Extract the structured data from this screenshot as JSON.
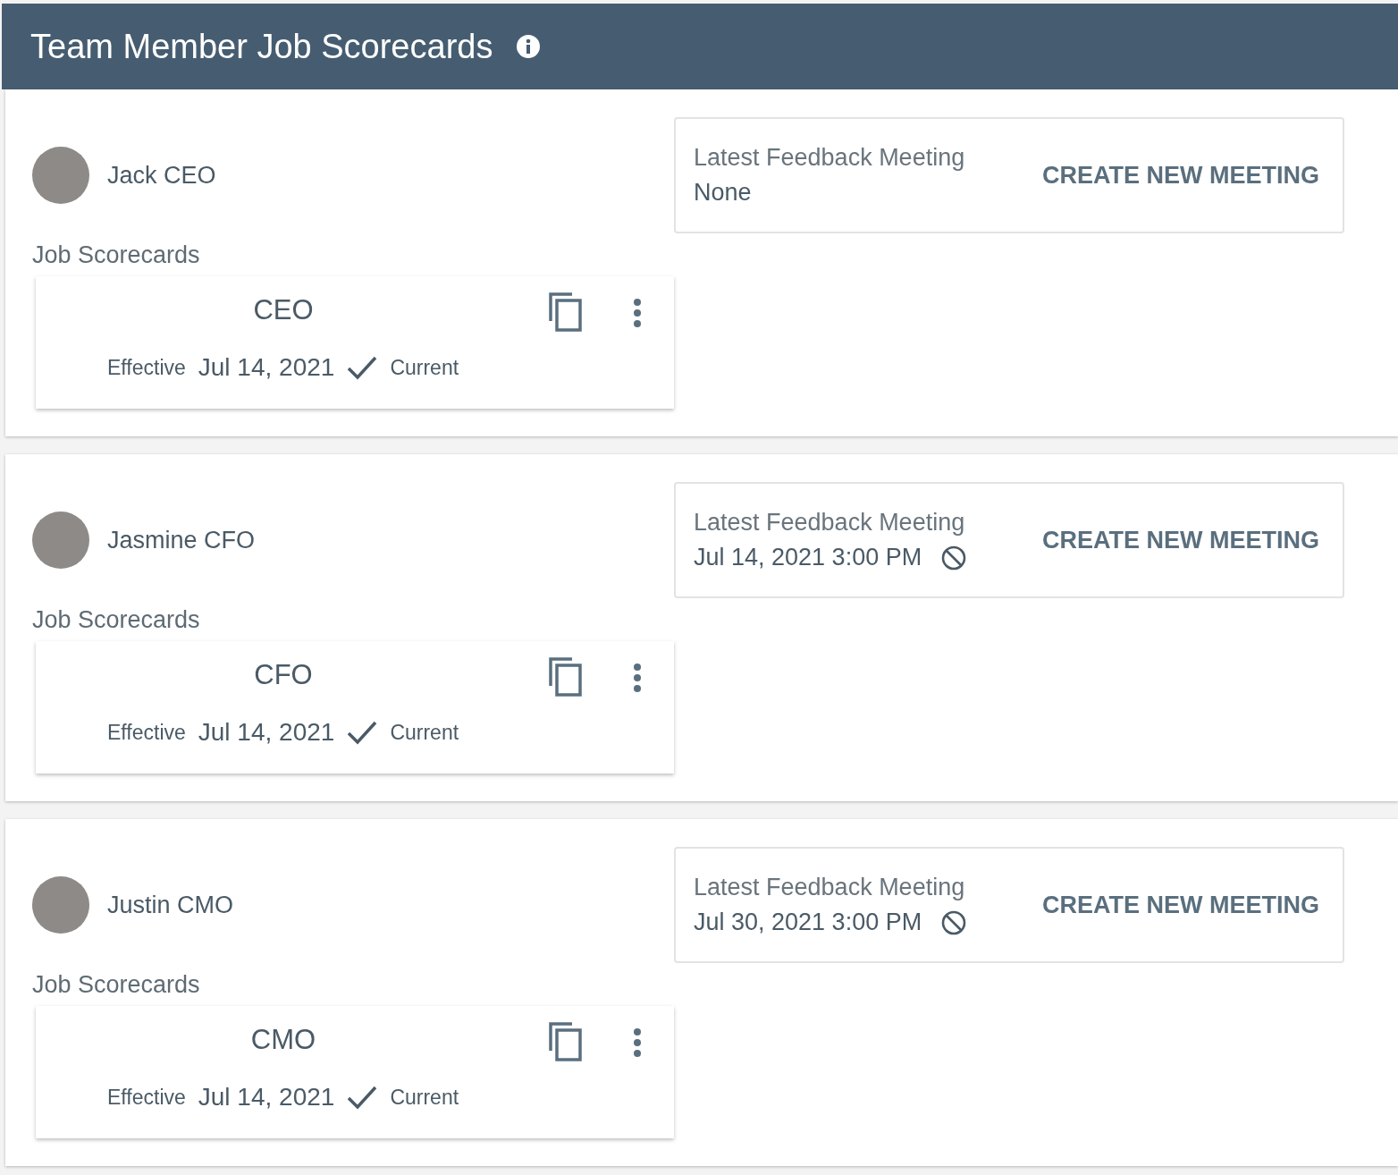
{
  "header": {
    "title": "Team Member Job Scorecards"
  },
  "members": [
    {
      "name": "Jack CEO",
      "feedback": {
        "label": "Latest Feedback Meeting",
        "value": "None",
        "kind": "empty"
      },
      "action": "CREATE NEW MEETING",
      "scorecards_label": "Job Scorecards",
      "scorecards": [
        {
          "title": "CEO",
          "effective_label": "Effective",
          "date": "Jul 14, 2021",
          "status": "Current",
          "current": true
        }
      ]
    },
    {
      "name": "Jasmine CFO",
      "feedback": {
        "label": "Latest Feedback Meeting",
        "value": "Jul 14, 2021 3:00 PM",
        "kind": "meeting"
      },
      "action": "CREATE NEW MEETING",
      "scorecards_label": "Job Scorecards",
      "scorecards": [
        {
          "title": "CFO",
          "effective_label": "Effective",
          "date": "Jul 14, 2021",
          "status": "Current",
          "current": true
        }
      ]
    },
    {
      "name": "Justin CMO",
      "feedback": {
        "label": "Latest Feedback Meeting",
        "value": "Jul 30, 2021 3:00 PM",
        "kind": "meeting"
      },
      "action": "CREATE NEW MEETING",
      "scorecards_label": "Job Scorecards",
      "scorecards": [
        {
          "title": "CMO",
          "effective_label": "Effective",
          "date": "Jul 14, 2021",
          "status": "Current",
          "current": true
        }
      ]
    }
  ]
}
